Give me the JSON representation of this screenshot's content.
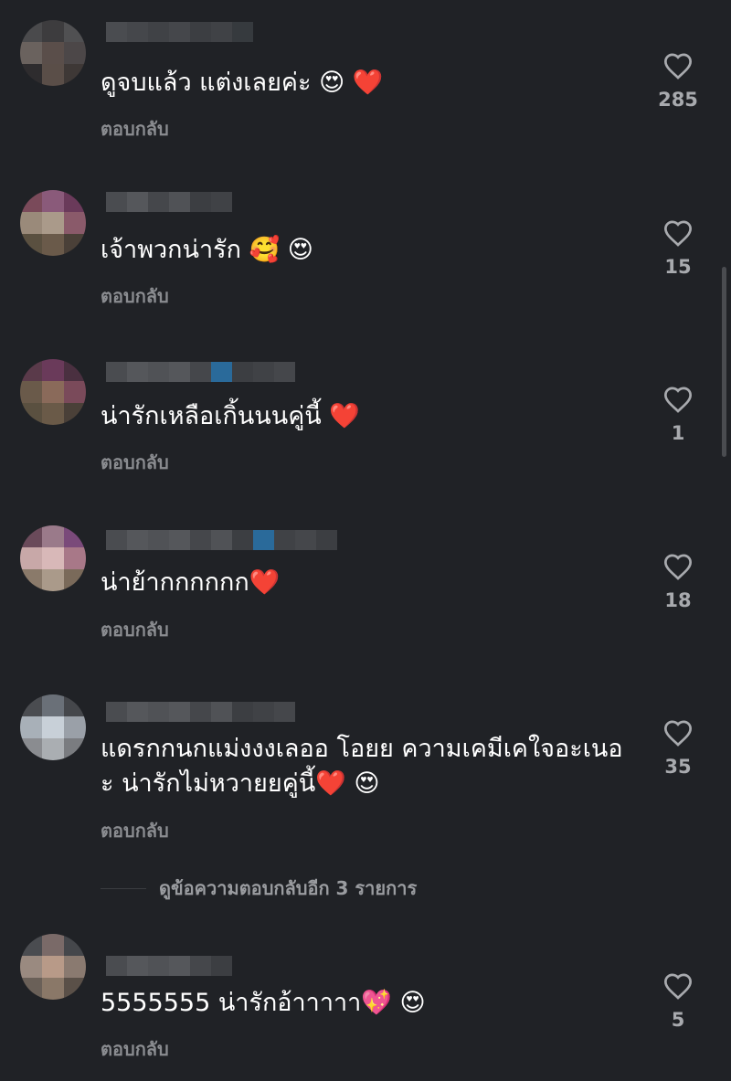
{
  "comments": [
    {
      "text": "ดูจบแล้ว แต่งเลยค่ะ",
      "emojis": "😍 ❤️",
      "reply_label": "ตอบกลับ",
      "likes": "285",
      "like_icon": "heart-outline-icon"
    },
    {
      "text": "เจ้าพวกน่ารัก",
      "emojis": "🥰 😍",
      "reply_label": "ตอบกลับ",
      "likes": "15",
      "like_icon": "heart-outline-icon"
    },
    {
      "text": "น่ารักเหลือเกิ้นนนคู่นี้",
      "emojis": "❤️",
      "reply_label": "ตอบกลับ",
      "likes": "1",
      "like_icon": "heart-outline-icon"
    },
    {
      "text": "น่าย้ากกกกกก",
      "emojis": "❤️",
      "reply_label": "ตอบกลับ",
      "likes": "18",
      "like_icon": "heart-outline-icon"
    },
    {
      "text_line1": "แดรกกนกแม่งงงเลออ โอยย ความเคมีเคใจอะเนอ",
      "text_line2": "ะ น่ารักไม่หวายยคู่นี้",
      "emojis": "❤️ 😍",
      "reply_label": "ตอบกลับ",
      "likes": "35",
      "like_icon": "heart-outline-icon",
      "more_replies": "ดูข้อความตอบกลับอีก 3 รายการ"
    },
    {
      "text": "5555555 น่ารักอ้าาาาา",
      "emojis": "💖 😍",
      "reply_label": "ตอบกลับ",
      "likes": "5",
      "like_icon": "heart-outline-icon"
    }
  ],
  "colors": {
    "background": "#202226",
    "text": "#ffffff",
    "secondary": "#8a8c90",
    "heart": "#e8202a"
  }
}
